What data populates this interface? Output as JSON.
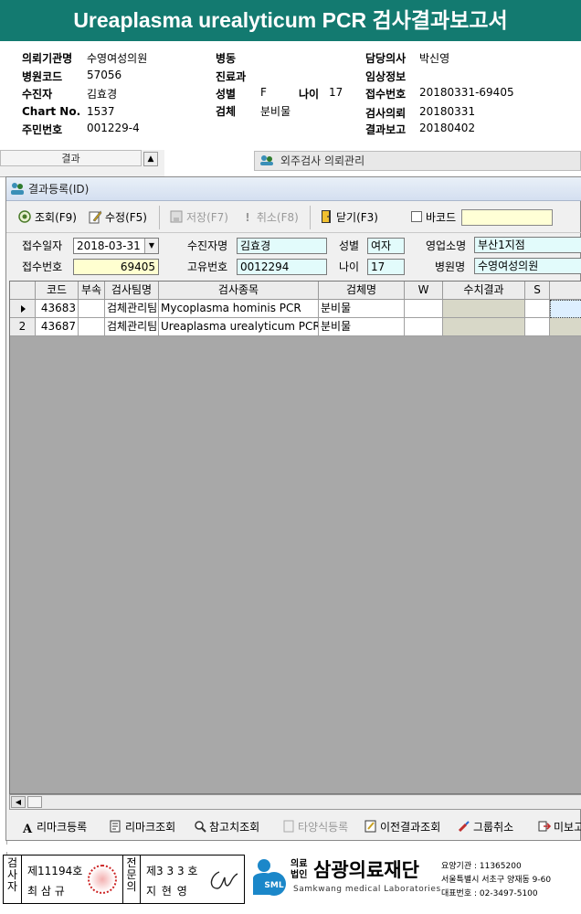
{
  "report": {
    "title": "Ureaplasma urealyticum PCR 검사결과보고서",
    "fields": {
      "institution_label": "의뢰기관명",
      "institution_value": "수영여성의원",
      "hospital_code_label": "병원코드",
      "hospital_code_value": "57056",
      "patient_label": "수진자",
      "patient_value": "김효경",
      "chart_label": "Chart No.",
      "chart_value": "1537",
      "resident_label": "주민번호",
      "resident_value": "001229-4",
      "ward_label": "병동",
      "department_label": "진료과",
      "sex_label": "성별",
      "sex_value": "F",
      "age_label": "나이",
      "age_value": "17",
      "specimen_label": "검체",
      "specimen_value": "분비물",
      "doctor_label": "담당의사",
      "doctor_value": "박신영",
      "clinical_label": "임상정보",
      "receipt_label": "접수번호",
      "receipt_value": "20180331-69405",
      "request_label": "검사의뢰",
      "request_value": "20180331",
      "result_label": "결과보고",
      "result_value": "20180402"
    }
  },
  "background": {
    "left_label": "결과",
    "outside_title": "외주검사 의뢰관리"
  },
  "dialog": {
    "title": "결과등록(ID)",
    "toolbar": {
      "search": "조회(F9)",
      "edit": "수정(F5)",
      "save": "저장(F7)",
      "cancel": "취소(F8)",
      "close": "닫기(F3)",
      "barcode": "바코드"
    },
    "form": {
      "receipt_date_label": "접수일자",
      "receipt_date_value": "2018-03-31",
      "patient_name_label": "수진자명",
      "patient_name_value": "김효경",
      "sex_label": "성별",
      "sex_value": "여자",
      "branch_label": "영업소명",
      "branch_value": "부산1지점",
      "receipt_no_label": "접수번호",
      "receipt_no_value": "69405",
      "unique_no_label": "고유번호",
      "unique_no_value": "0012294",
      "age_label": "나이",
      "age_value": "17",
      "hospital_label": "병원명",
      "hospital_value": "수영여성의원"
    },
    "grid": {
      "columns": [
        "코드",
        "부속",
        "검사팀명",
        "검사종목",
        "검체명",
        "W",
        "수치결과",
        "S"
      ],
      "rows": [
        {
          "no": "",
          "code": "43683",
          "sub": "",
          "team": "검체관리팀",
          "item": "Mycoplasma hominis PCR",
          "specimen": "분비물",
          "w": "",
          "value": "",
          "s": ""
        },
        {
          "no": "2",
          "code": "43687",
          "sub": "",
          "team": "검체관리팀",
          "item": "Ureaplasma urealyticum PCR",
          "specimen": "분비물",
          "w": "",
          "value": "",
          "s": ""
        }
      ]
    },
    "bottom": {
      "remark_reg": "리마크등록",
      "remark_view": "리마크조회",
      "ref_view": "참고치조회",
      "multi_reg": "타양식등록",
      "prev_view": "이전결과조회",
      "group_cancel": "그룹취소",
      "unreported": "미보고"
    }
  },
  "footer": {
    "checker_label": "검사자",
    "checker_no": "제11194호",
    "checker_name": "최 삼 규",
    "specialist_label": "전문의",
    "specialist_no": "제3 3 3 호",
    "specialist_name": "지 현 영",
    "foundation_small1": "의료",
    "foundation_small2": "법인",
    "foundation_name": "삼광의료재단",
    "foundation_en": "Samkwang medical Laboratories",
    "logo_text": "SML",
    "info1": "요양기관 : 11365200",
    "info2": "서울특별시 서초구 양재동 9-60",
    "info3": "대표번호 : 02-3497-5100"
  }
}
